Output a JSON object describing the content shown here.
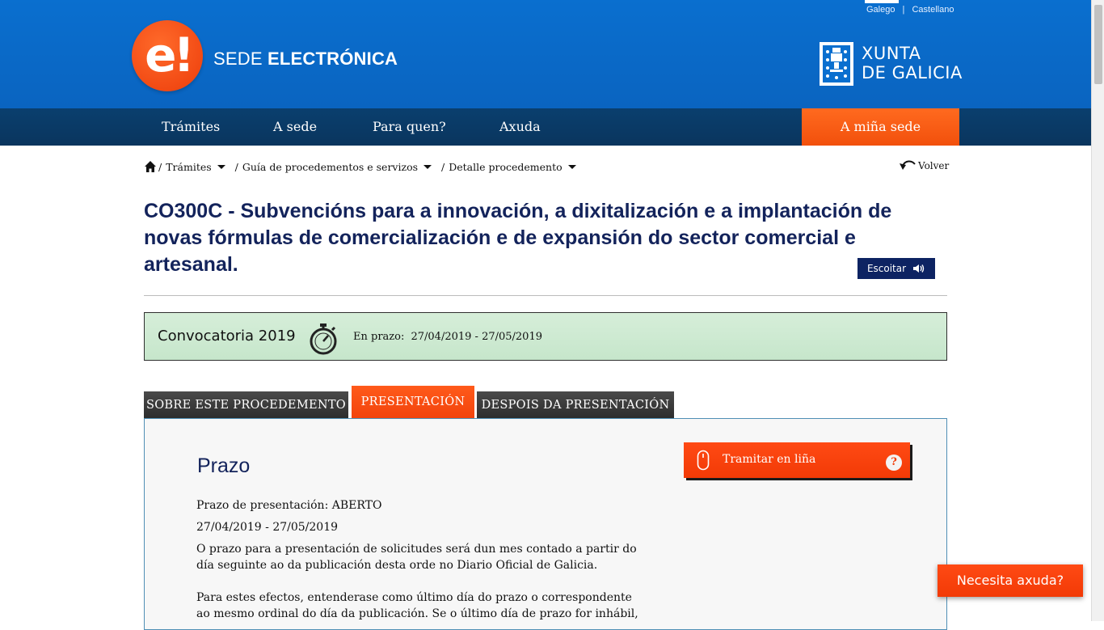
{
  "header": {
    "languages": [
      "Galego",
      "Castellano"
    ],
    "logo_glyph": "e!",
    "brand_prefix": "SEDE ",
    "brand_bold": "ELECTRÓNICA",
    "xunta_line1": "XUNTA",
    "xunta_line2": "DE GALICIA"
  },
  "nav": {
    "items": [
      "Trámites",
      "A sede",
      "Para quen?",
      "Axuda"
    ],
    "cta": "A miña sede"
  },
  "breadcrumb": {
    "items": [
      "Trámites",
      "Guía de procedementos e servizos",
      "Detalle procedemento"
    ],
    "back": "Volver"
  },
  "title": "CO300C - Subvencións para a innovación, a dixitalización e a implantación de novas fórmulas de comercialización e de expansión do sector comercial e artesanal.",
  "listen_button": "Escoitar",
  "convocatoria": {
    "label": "Convocatoria 2019",
    "period_label": "En prazo:",
    "period": "27/04/2019 - 27/05/2019"
  },
  "tabs": [
    {
      "label": "SOBRE ESTE PROCEDEMENTO",
      "active": false
    },
    {
      "label": "PRESENTACIÓN",
      "active": true
    },
    {
      "label": "DESPOIS DA PRESENTACIÓN",
      "active": false
    }
  ],
  "content": {
    "heading": "Prazo",
    "status_line": "Prazo de presentación: ABERTO",
    "dates": "27/04/2019 - 27/05/2019",
    "paragraph1": "O prazo para a presentación de solicitudes será dun mes contado a partir do día seguinte ao da publicación desta orde no Diario Oficial de Galicia.",
    "paragraph2": "Para estes efectos, entenderase como último día do prazo o correspondente ao mesmo ordinal do día da publicación. Se o último día de prazo for inhábil,"
  },
  "tramitar_button": "Tramitar en liña",
  "help_glyph": "?",
  "help_widget": "Necesita axuda?",
  "colors": {
    "header_blue": "#0a6fcf",
    "nav_dark": "#0a3f6e",
    "accent_orange": "#f2500c",
    "title_navy": "#13235b",
    "convocatoria_green": "#cbe9cf"
  }
}
